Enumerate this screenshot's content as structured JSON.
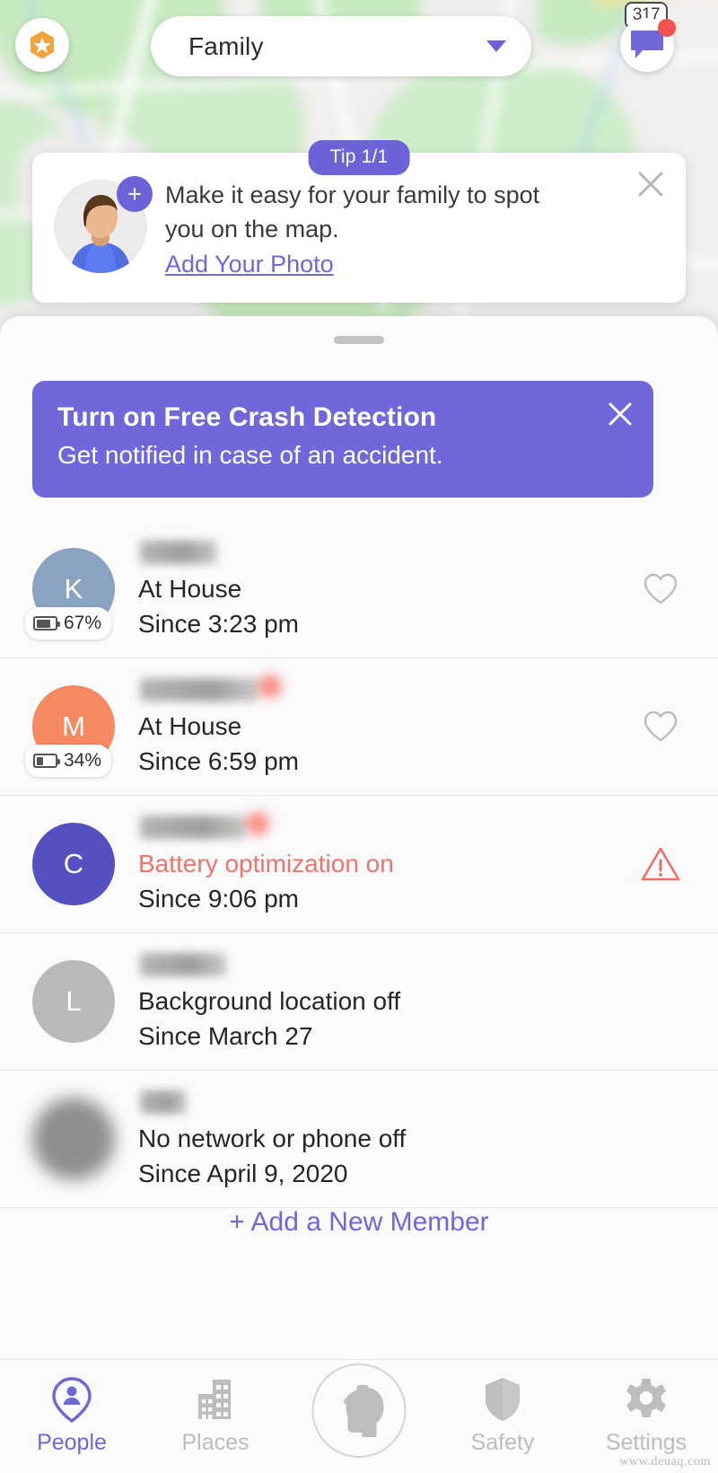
{
  "map": {
    "highway_shield_label": "317"
  },
  "topbar": {
    "star_badge_icon": "star-hexagon-icon",
    "circle_name": "Family",
    "circle_dropdown_icon": "chevron-down-icon",
    "messages_icon": "chat-bubble-icon",
    "messages_unread_indicator": true
  },
  "tip": {
    "badge": "Tip 1/1",
    "avatar_icon": "person-avatar-illustration",
    "add_photo_plus_icon": "plus-icon",
    "line1": "Make it easy for your family to spot",
    "line2": "you on the map.",
    "link": "Add Your Photo",
    "close_icon": "close-icon"
  },
  "sheet": {
    "grabber_icon": "drag-handle",
    "crash_banner": {
      "title": "Turn on Free Crash Detection",
      "subtitle": "Get notified in case of an accident.",
      "close_icon": "close-icon",
      "background_color": "#6f67da"
    },
    "add_member_label": "+ Add a New Member"
  },
  "members": [
    {
      "initial": "K",
      "avatar_color": "#8ba3c2",
      "name_redacted": true,
      "name_has_alert_dot": false,
      "battery": "67%",
      "battery_level": 67,
      "status": "At House",
      "status_alert": false,
      "since": "Since 3:23 pm",
      "action_icon": "heart-outline-icon",
      "action_alert": false
    },
    {
      "initial": "M",
      "avatar_color": "#f58a62",
      "name_redacted": true,
      "name_has_alert_dot": true,
      "battery": "34%",
      "battery_level": 34,
      "status": "At House",
      "status_alert": false,
      "since": "Since 6:59 pm",
      "action_icon": "heart-outline-icon",
      "action_alert": false
    },
    {
      "initial": "C",
      "avatar_color": "#5450c0",
      "name_redacted": true,
      "name_has_alert_dot": true,
      "battery": null,
      "battery_level": null,
      "status": "Battery optimization on",
      "status_alert": true,
      "since": "Since 9:06 pm",
      "action_icon": "warning-triangle-icon",
      "action_alert": true
    },
    {
      "initial": "L",
      "avatar_color": "#b9b9b9",
      "name_redacted": true,
      "name_has_alert_dot": false,
      "battery": null,
      "battery_level": null,
      "status": "Background location off",
      "status_alert": false,
      "since": "Since March 27",
      "action_icon": null,
      "action_alert": false
    },
    {
      "initial": "",
      "avatar_color": "#8e8e8e",
      "avatar_blurred": true,
      "name_redacted": true,
      "name_has_alert_dot": false,
      "battery": null,
      "battery_level": null,
      "status": "No network or phone off",
      "status_alert": false,
      "since": "Since April 9, 2020",
      "action_icon": null,
      "action_alert": false
    }
  ],
  "tabbar": {
    "items": [
      {
        "label": "People",
        "icon": "person-pin-icon",
        "active": true
      },
      {
        "label": "Places",
        "icon": "buildings-icon",
        "active": false
      },
      {
        "label": "",
        "icon": "driver-head-icon",
        "active": false
      },
      {
        "label": "Safety",
        "icon": "shield-icon",
        "active": false
      },
      {
        "label": "Settings",
        "icon": "gear-icon",
        "active": false
      }
    ],
    "active_color": "#6f67da",
    "inactive_color": "#bdbdbd"
  },
  "watermark": "www.deuaq.com"
}
